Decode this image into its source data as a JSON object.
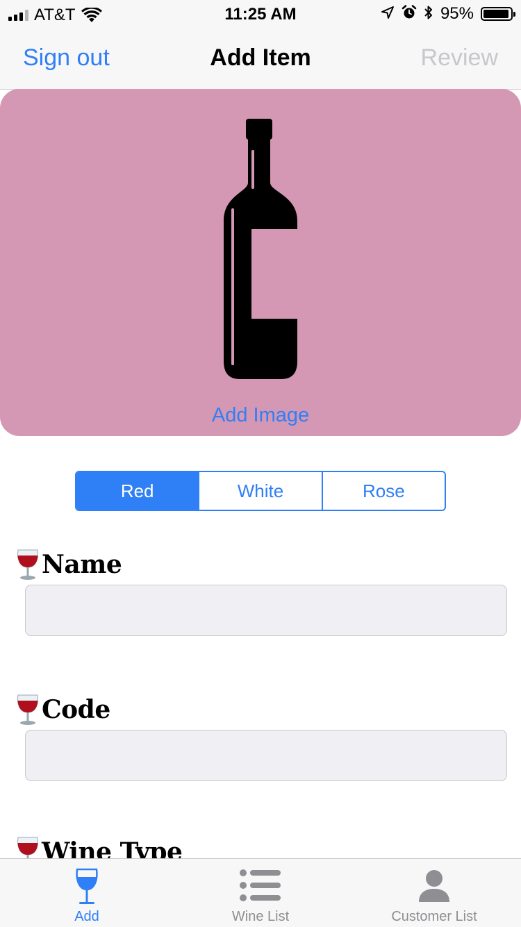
{
  "status_bar": {
    "carrier": "AT&T",
    "time": "11:25 AM",
    "battery_percent": "95%",
    "battery_level": 0.95,
    "signal_bars_on": 3,
    "signal_bars_total": 4,
    "icons": [
      "signal-icon",
      "wifi-icon",
      "location-arrow-icon",
      "alarm-icon",
      "bluetooth-icon",
      "battery-icon"
    ]
  },
  "nav": {
    "left_label": "Sign out",
    "title": "Add Item",
    "right_label": "Review"
  },
  "image_card": {
    "background": "#d598b4",
    "placeholder_icon": "wine-bottle-icon",
    "add_image_label": "Add Image"
  },
  "wine_color_segments": {
    "options": [
      "Red",
      "White",
      "Rose"
    ],
    "selected": "Red"
  },
  "form": {
    "fields": [
      {
        "icon": "wine-glass-icon",
        "label": "Name",
        "value": ""
      },
      {
        "icon": "wine-glass-icon",
        "label": "Code",
        "value": ""
      },
      {
        "icon": "wine-glass-icon",
        "label": "Wine Type",
        "value": ""
      }
    ]
  },
  "tab_bar": {
    "items": [
      {
        "label": "Add",
        "icon": "wine-glass-icon",
        "active": true
      },
      {
        "label": "Wine List",
        "icon": "list-icon",
        "active": false
      },
      {
        "label": "Customer List",
        "icon": "person-icon",
        "active": false
      }
    ]
  },
  "colors": {
    "accent": "#2f7ff6",
    "disabled": "#c7c7cc",
    "input_bg": "#efeff4",
    "wine_red": "#b0101d"
  }
}
